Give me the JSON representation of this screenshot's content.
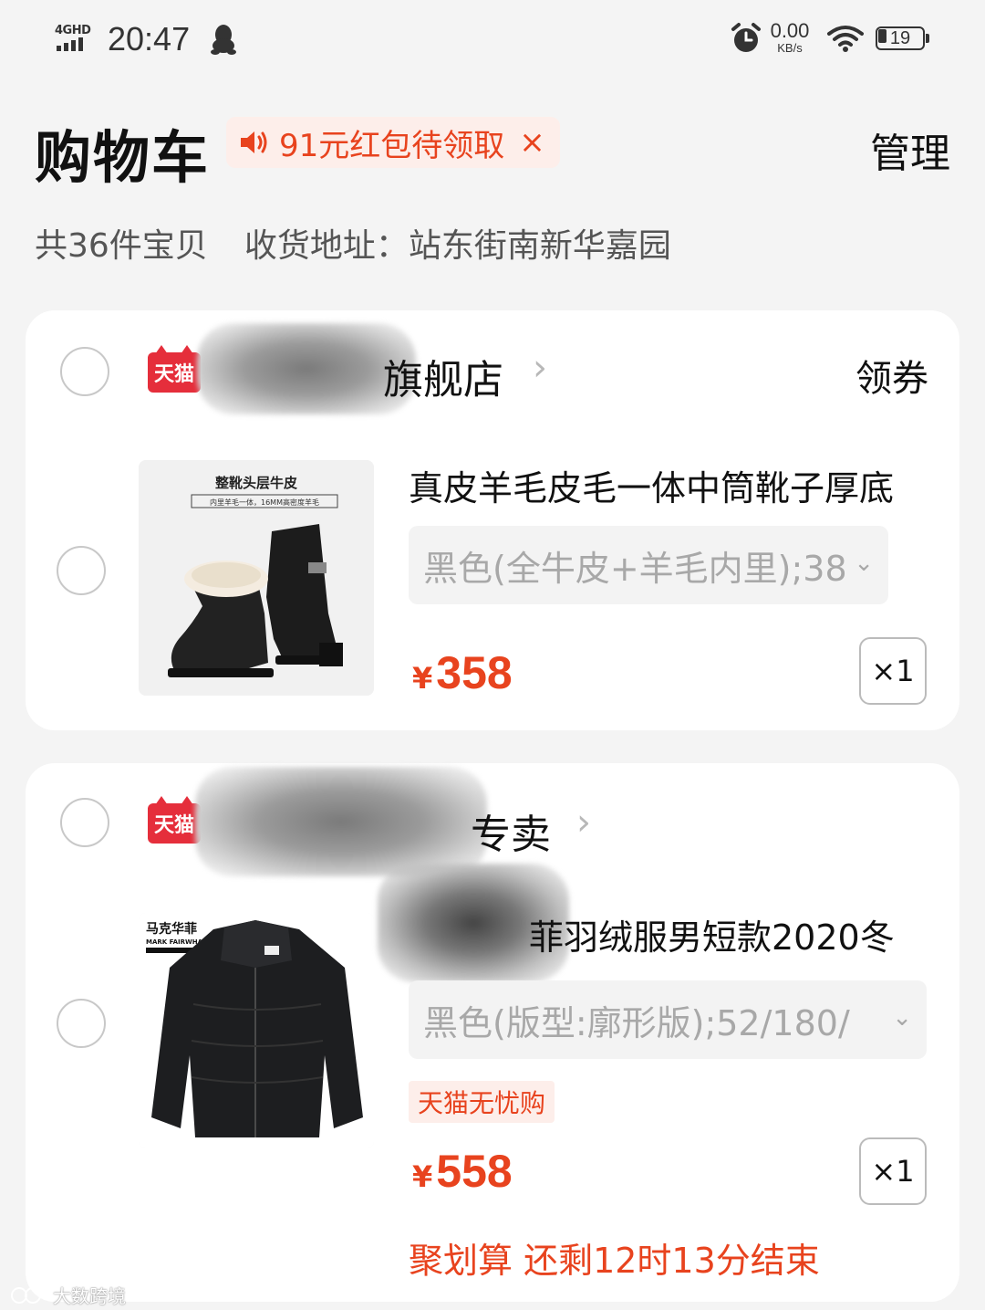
{
  "status_bar": {
    "network": "4GHD",
    "time": "20:47",
    "speed_value": "0.00",
    "speed_unit": "KB/s",
    "battery": "19",
    "battery_level_percent": 19
  },
  "header": {
    "title": "购物车",
    "promo_text": "91元红包待领取",
    "promo_close": "×",
    "manage_label": "管理"
  },
  "summary": {
    "item_count": "共36件宝贝",
    "address": "收货地址：站东街南新华嘉园"
  },
  "shops": [
    {
      "badge": "天猫",
      "name_visible": "旗舰店",
      "chevron": "›",
      "coupon_label": "领券",
      "product": {
        "image_caption": "整靴头层牛皮",
        "image_subcaption": "内里羊毛一体，16MM高密度羊毛",
        "title": "真皮羊毛皮毛一体中筒靴子厚底",
        "sku": "黑色(全牛皮+羊毛内里);38",
        "currency": "¥",
        "price": "358",
        "quantity": "×1"
      }
    },
    {
      "badge": "天猫",
      "name_visible": "专卖",
      "chevron": "›",
      "product": {
        "brand_cn": "马克华菲",
        "brand_en": "MARK FAIRWHALE",
        "title_visible": "菲羽绒服男短款2020冬",
        "sku": "黑色(版型:廓形版);52/180/",
        "tag": "天猫无忧购",
        "currency": "¥",
        "price": "558",
        "quantity": "×1",
        "deal": "聚划算 还剩12时13分结束"
      }
    }
  ],
  "watermark": "大数跨境",
  "colors": {
    "accent": "#e8431e",
    "tmall_red": "#e52e3b",
    "promo_bg": "#fdeeea",
    "page_bg": "#f4f4f4"
  }
}
